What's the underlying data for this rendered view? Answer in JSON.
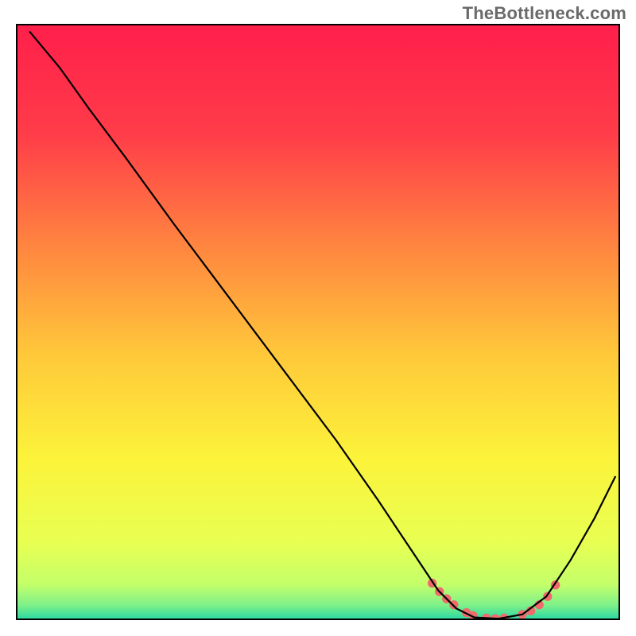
{
  "watermark": "TheBottleneck.com",
  "chart_data": {
    "type": "line",
    "title": "",
    "xlabel": "",
    "ylabel": "",
    "x_range": [
      0,
      100
    ],
    "y_range": [
      0,
      100
    ],
    "gradient_stops": [
      {
        "offset": 0.0,
        "color": "#ff1f4b"
      },
      {
        "offset": 0.18,
        "color": "#ff3c49"
      },
      {
        "offset": 0.38,
        "color": "#ff8a3f"
      },
      {
        "offset": 0.55,
        "color": "#ffc93a"
      },
      {
        "offset": 0.72,
        "color": "#fcf33a"
      },
      {
        "offset": 0.86,
        "color": "#e8ff52"
      },
      {
        "offset": 0.93,
        "color": "#c4ff6a"
      },
      {
        "offset": 0.965,
        "color": "#7df089"
      },
      {
        "offset": 0.985,
        "color": "#35dba0"
      },
      {
        "offset": 1.0,
        "color": "#19c9a0"
      }
    ],
    "series": [
      {
        "name": "bottleneck-curve",
        "color": "#000000",
        "width": 2.2,
        "points": [
          {
            "x": 2.0,
            "y": 99.0
          },
          {
            "x": 7.0,
            "y": 93.0
          },
          {
            "x": 12.0,
            "y": 86.0
          },
          {
            "x": 18.0,
            "y": 78.0
          },
          {
            "x": 26.0,
            "y": 67.0
          },
          {
            "x": 35.0,
            "y": 55.0
          },
          {
            "x": 44.0,
            "y": 43.0
          },
          {
            "x": 53.0,
            "y": 31.0
          },
          {
            "x": 60.0,
            "y": 21.0
          },
          {
            "x": 66.0,
            "y": 12.0
          },
          {
            "x": 70.0,
            "y": 6.0
          },
          {
            "x": 73.0,
            "y": 3.0
          },
          {
            "x": 76.0,
            "y": 1.5
          },
          {
            "x": 80.0,
            "y": 1.3
          },
          {
            "x": 84.0,
            "y": 2.0
          },
          {
            "x": 88.0,
            "y": 5.0
          },
          {
            "x": 92.0,
            "y": 11.0
          },
          {
            "x": 96.0,
            "y": 18.0
          },
          {
            "x": 99.5,
            "y": 25.0
          }
        ]
      },
      {
        "name": "highlight-dots",
        "color": "#ef6b6b",
        "radius": 5.5,
        "points": [
          {
            "x": 69.0,
            "y": 7.2
          },
          {
            "x": 70.2,
            "y": 5.8
          },
          {
            "x": 71.4,
            "y": 4.6
          },
          {
            "x": 72.6,
            "y": 3.6
          },
          {
            "x": 74.7,
            "y": 2.3
          },
          {
            "x": 75.8,
            "y": 1.8
          },
          {
            "x": 78.0,
            "y": 1.4
          },
          {
            "x": 79.5,
            "y": 1.3
          },
          {
            "x": 81.0,
            "y": 1.4
          },
          {
            "x": 84.0,
            "y": 2.0
          },
          {
            "x": 85.4,
            "y": 2.6
          },
          {
            "x": 86.8,
            "y": 3.6
          },
          {
            "x": 88.2,
            "y": 5.0
          },
          {
            "x": 89.5,
            "y": 6.9
          }
        ]
      }
    ]
  }
}
